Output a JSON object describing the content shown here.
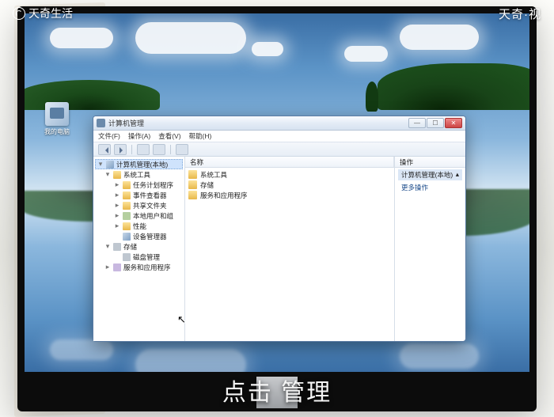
{
  "overlay": {
    "logo_left": "天奇生活",
    "logo_right": "天奇·视"
  },
  "caption": "点击 管理",
  "desktop": {
    "icon_label": "我的电脑"
  },
  "window": {
    "title": "计算机管理",
    "menu": [
      "文件(F)",
      "操作(A)",
      "查看(V)",
      "帮助(H)"
    ],
    "tree": [
      {
        "label": "计算机管理(本地)",
        "icon": "mon",
        "indent": 0,
        "tw": "▾",
        "sel": true
      },
      {
        "label": "系统工具",
        "icon": "fld",
        "indent": 1,
        "tw": "▾"
      },
      {
        "label": "任务计划程序",
        "icon": "fld",
        "indent": 2,
        "tw": "▸"
      },
      {
        "label": "事件查看器",
        "icon": "fld",
        "indent": 2,
        "tw": "▸"
      },
      {
        "label": "共享文件夹",
        "icon": "fld",
        "indent": 2,
        "tw": "▸"
      },
      {
        "label": "本地用户和组",
        "icon": "grp",
        "indent": 2,
        "tw": "▸"
      },
      {
        "label": "性能",
        "icon": "fld",
        "indent": 2,
        "tw": "▸"
      },
      {
        "label": "设备管理器",
        "icon": "mon",
        "indent": 2,
        "tw": ""
      },
      {
        "label": "存储",
        "icon": "disk",
        "indent": 1,
        "tw": "▾"
      },
      {
        "label": "磁盘管理",
        "icon": "disk",
        "indent": 2,
        "tw": ""
      },
      {
        "label": "服务和应用程序",
        "icon": "svc",
        "indent": 1,
        "tw": "▸"
      }
    ],
    "list_header": "名称",
    "list_items": [
      "系统工具",
      "存储",
      "服务和应用程序"
    ],
    "actions_header": "操作",
    "actions_section_title": "计算机管理(本地)",
    "actions_section_caret": "▴",
    "actions_link": "更多操作"
  }
}
